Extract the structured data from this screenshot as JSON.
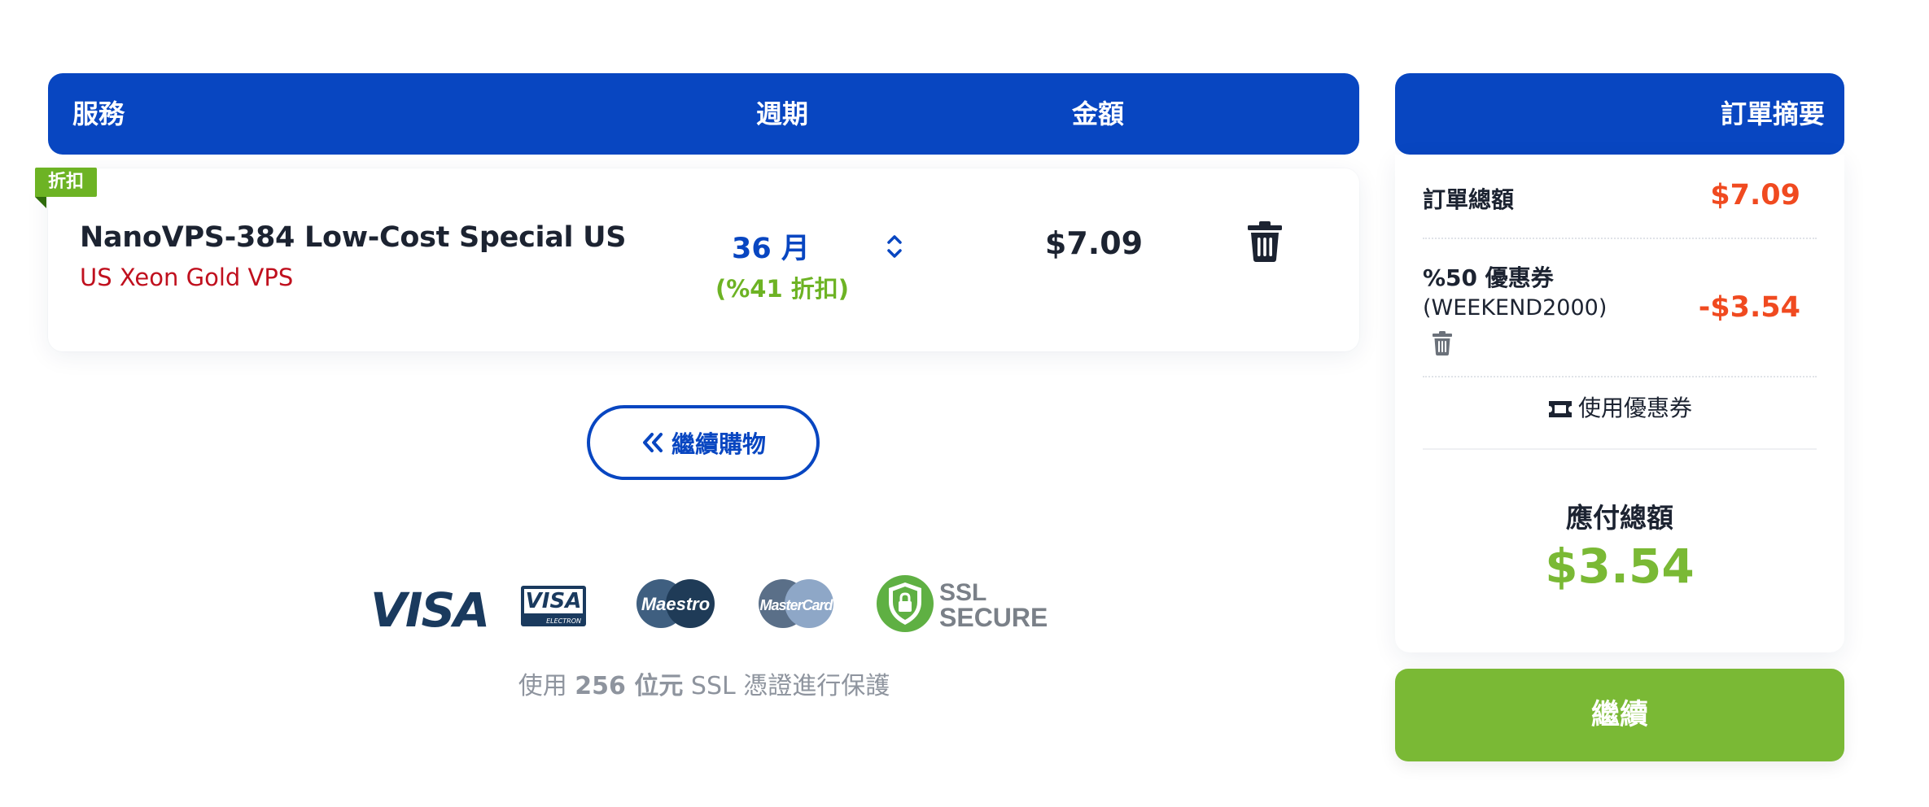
{
  "cart": {
    "headers": {
      "service": "服務",
      "cycle": "週期",
      "amount": "金額"
    },
    "items": [
      {
        "badge": "折扣",
        "name": "NanoVPS-384 Low-Cost Special US",
        "subtitle": "US Xeon Gold VPS",
        "cycle": "36 月",
        "cycle_discount": "(%41 折扣)",
        "price": "$7.09",
        "delete_icon": "trash-icon"
      }
    ],
    "continue_shopping_label": "繼續購物",
    "continue_shopping_icon": "double-chevron-left-icon"
  },
  "payments": {
    "logos": [
      {
        "name": "visa-logo",
        "text": "VISA"
      },
      {
        "name": "visa-electron-logo",
        "text": "VISA",
        "subtext": "ELECTRON"
      },
      {
        "name": "maestro-logo",
        "text": "Maestro"
      },
      {
        "name": "mastercard-logo",
        "text": "MasterCard"
      },
      {
        "name": "ssl-secure-logo",
        "text": "SSL",
        "subtext": "SECURE"
      }
    ],
    "ssl_note_prefix": "使用 ",
    "ssl_note_bold": "256 位元",
    "ssl_note_suffix": " SSL 憑證進行保護"
  },
  "summary": {
    "title": "訂單摘要",
    "order_total_label": "訂單總額",
    "order_total_value": "$7.09",
    "coupon_label": "%50 優惠券",
    "coupon_code": "(WEEKEND2000)",
    "coupon_value": "-$3.54",
    "use_coupon_label": "使用優惠券",
    "use_coupon_icon": "ticket-icon",
    "payable_label": "應付總額",
    "payable_value": "$3.54"
  },
  "checkout": {
    "label": "繼續"
  },
  "colors": {
    "primary_blue": "#0846c1",
    "accent_green": "#7ab935",
    "discount_green": "#6db324",
    "price_red": "#f04a20",
    "subtitle_red": "#c0101e"
  }
}
